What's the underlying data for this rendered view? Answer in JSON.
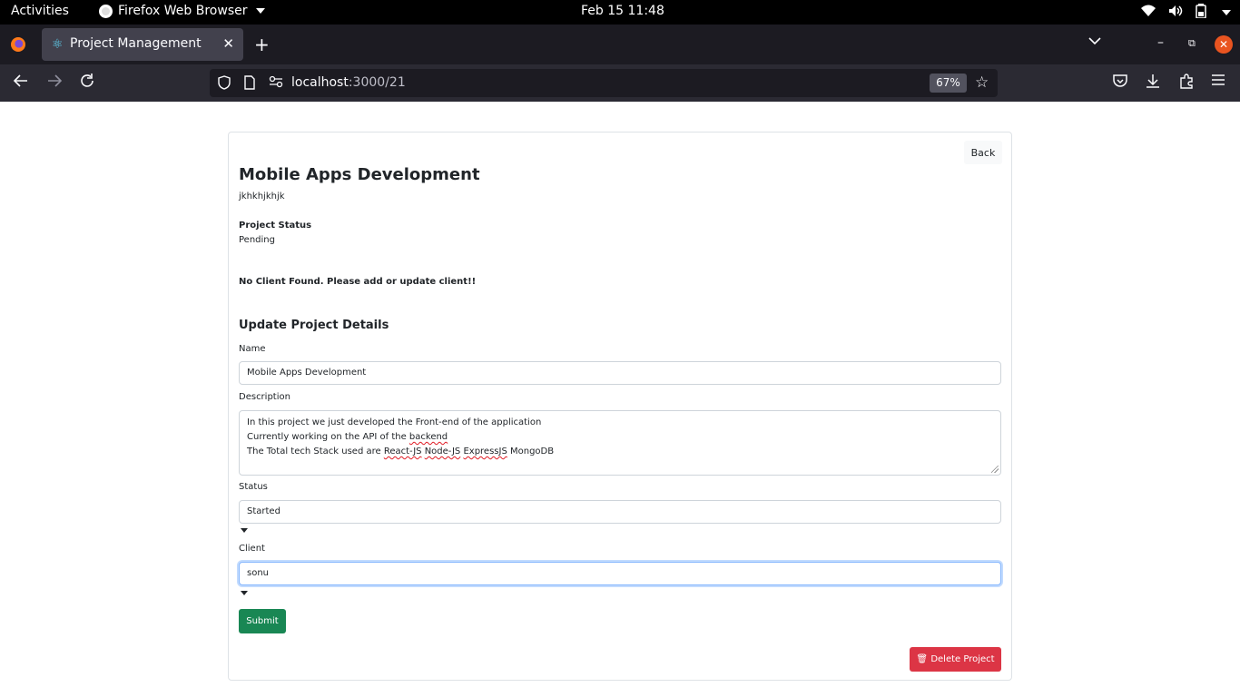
{
  "system": {
    "activities": "Activities",
    "app_name": "Firefox Web Browser",
    "clock": "Feb 15  11:48"
  },
  "browser": {
    "tab_title": "Project Management",
    "url_host": "localhost",
    "url_rest": ":3000/21",
    "zoom": "67%"
  },
  "page": {
    "back_label": "Back",
    "project_name": "Mobile Apps Development",
    "project_description": "jkhkhjkhjk",
    "status_label": "Project Status",
    "status_value": "Pending",
    "no_client_message": "No Client Found. Please add or update client!!",
    "update_title": "Update Project Details",
    "form": {
      "name_label": "Name",
      "name_value": "Mobile Apps Development",
      "description_label": "Description",
      "description_lines": [
        "In this project we just developed the Front-end of the application",
        "Currently working on the API of the backend",
        "The Total tech Stack used are React-JS Node-JS ExpressJS MongoDB"
      ],
      "status_label": "Status",
      "status_value": "Started",
      "client_label": "Client",
      "client_value": "sonu",
      "submit_label": "Submit",
      "delete_label": "Delete Project"
    }
  },
  "colors": {
    "submit": "#198754",
    "delete": "#dc3545",
    "focus_border": "#86b7fe",
    "topbar": "#000000",
    "close_button": "#e95420"
  },
  "icons": [
    "firefox-icon",
    "react-icon",
    "back-arrow-icon",
    "forward-arrow-icon",
    "reload-icon",
    "shield-icon",
    "page-icon",
    "permissions-icon",
    "star-icon",
    "pocket-icon",
    "download-icon",
    "extensions-icon",
    "menu-icon",
    "trash-icon"
  ]
}
